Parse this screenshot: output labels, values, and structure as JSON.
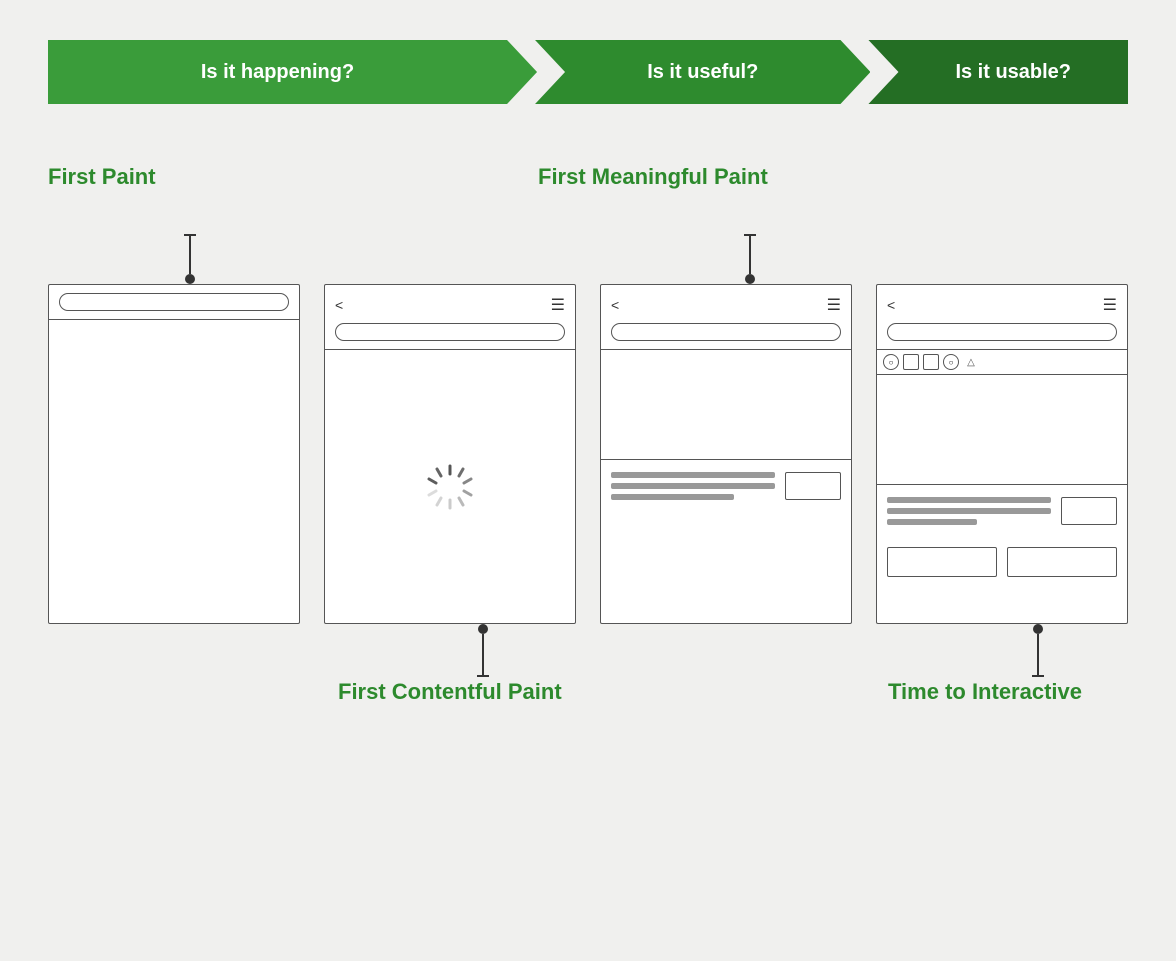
{
  "banner": {
    "arrow1_label": "Is it happening?",
    "arrow2_label": "Is it useful?",
    "arrow3_label": "Is it usable?",
    "color1": "#3ea83e",
    "color2": "#2f8f2f",
    "color3": "#246e24"
  },
  "labels": {
    "first_paint": "First Paint",
    "first_meaningful_paint": "First Meaningful Paint",
    "first_contentful_paint": "First Contentful Paint",
    "time_to_interactive": "Time to Interactive"
  },
  "screens": [
    {
      "id": "fp",
      "type": "blank"
    },
    {
      "id": "fcp",
      "type": "loading"
    },
    {
      "id": "fmp",
      "type": "partial"
    },
    {
      "id": "tti",
      "type": "full"
    }
  ]
}
